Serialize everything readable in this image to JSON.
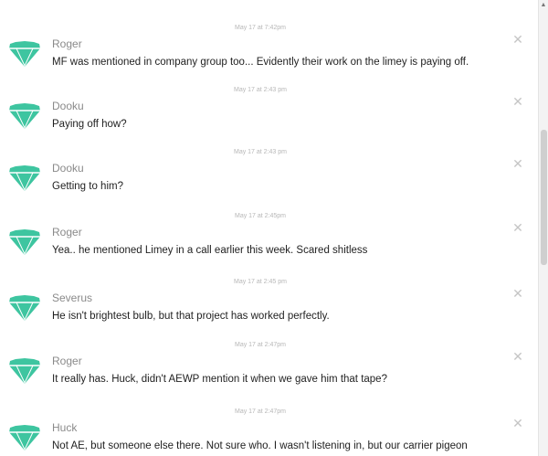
{
  "colors": {
    "avatar": "#3ec5a0",
    "sender": "#8a8a8a",
    "timestamp": "#b7b7b7",
    "message": "#1f1f1f"
  },
  "avatar_icon": "diamond-icon",
  "close_icon": "close-icon",
  "messages": [
    {
      "sender": "Roger",
      "timestamp": "May 17 at 7:42pm",
      "text": "MF was mentioned in company group too... Evidently their work on the limey is paying off."
    },
    {
      "sender": "Dooku",
      "timestamp": "May 17 at 2:43 pm",
      "text": "Paying off how?"
    },
    {
      "sender": "Dooku",
      "timestamp": "May 17 at 2:43 pm",
      "text": "Getting to him?"
    },
    {
      "sender": "Roger",
      "timestamp": "May 17 at 2:45pm",
      "text": "Yea.. he mentioned Limey in a call earlier this week. Scared shitless"
    },
    {
      "sender": "Severus",
      "timestamp": "May 17 at 2:45 pm",
      "text": "He isn't brightest bulb, but that project has worked perfectly."
    },
    {
      "sender": "Roger",
      "timestamp": "May 17 at 2:47pm",
      "text": "It really has. Huck, didn't AEWP mention it when we gave him that tape?"
    },
    {
      "sender": "Huck",
      "timestamp": "May 17 at 2:47pm",
      "text": "Not AE, but someone else there. Not sure who. I wasn't listening in, but our carrier pigeon"
    }
  ]
}
